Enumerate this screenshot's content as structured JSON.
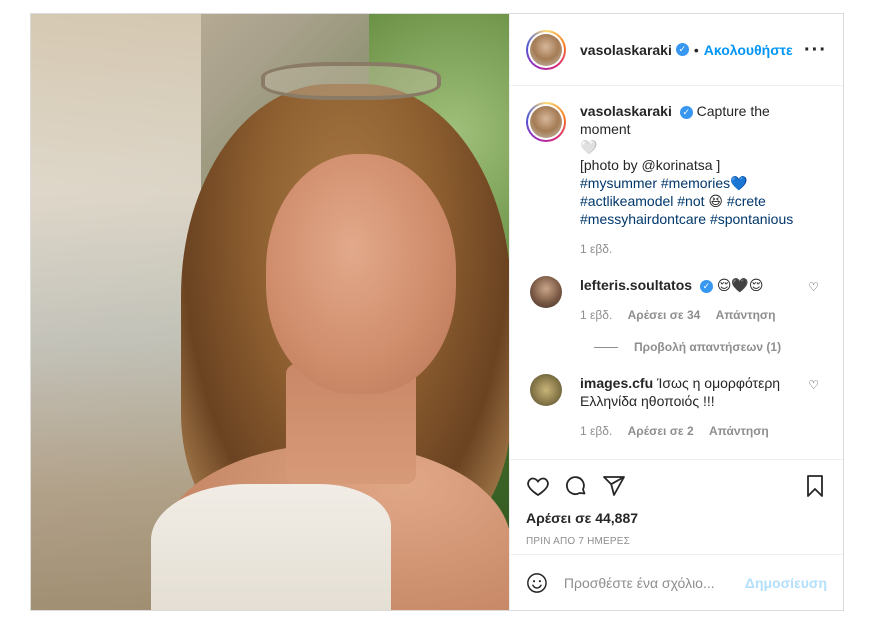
{
  "header": {
    "username": "vasolaskaraki",
    "separator": "•",
    "follow_label": "Ακολουθήστε",
    "more_icon": "more-horizontal-icon"
  },
  "caption": {
    "username": "vasolaskaraki",
    "line1": "Capture the moment",
    "line1b": "🤍",
    "line2": "[photo by @korinatsa ]",
    "tags_line1": "#mysummer #memories💙",
    "tags_line2_a": "#actlikeamodel #not",
    "tags_line2_emoji": "😆",
    "tags_line2_b": "#crete",
    "tags_line3": "#messyhairdontcare #spontanious",
    "age": "1 εβδ."
  },
  "comments": [
    {
      "username": "lefteris.soultatos",
      "text": "😌🖤😌",
      "age": "1 εβδ.",
      "likes": "Αρέσει σε 34",
      "reply": "Απάντηση",
      "view_replies": "Προβολή απαντήσεων (1)"
    },
    {
      "username": "images.cfu",
      "text": "Ίσως η ομορφότερη Ελληνίδα ηθοποιός !!!",
      "age": "1 εβδ.",
      "likes": "Αρέσει σε 2",
      "reply": "Απάντηση"
    }
  ],
  "actions": {
    "likes_label": "Αρέσει σε 44,887",
    "time_label": "ΠΡΙΝ ΑΠΟ 7 ΗΜΕΡΕΣ"
  },
  "add_comment": {
    "placeholder": "Προσθέστε ένα σχόλιο...",
    "post_label": "Δημοσίευση"
  },
  "colors": {
    "link": "#0095f6",
    "verified": "#3897f0",
    "hashtag": "#00376b",
    "muted": "#8e8e8e",
    "post_disabled": "#b2dffc"
  }
}
